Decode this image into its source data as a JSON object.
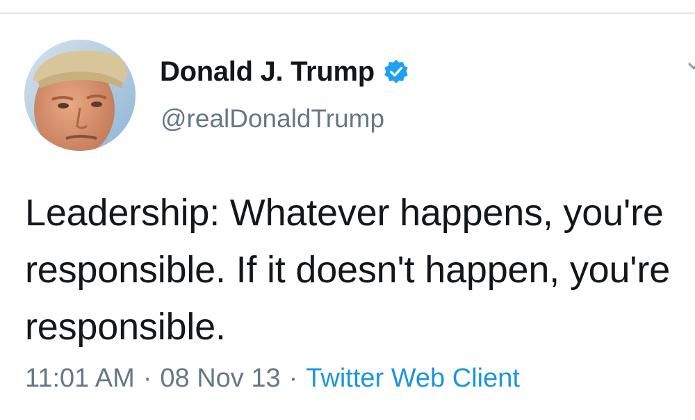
{
  "tweet": {
    "author": {
      "display_name": "Donald J. Trump",
      "handle": "@realDonaldTrump",
      "verified": true,
      "avatar_icon": "user-avatar-portrait"
    },
    "text": "Leadership: Whatever happens, you're responsible. If it doesn't happen, you're responsible.",
    "time": "11:01 AM",
    "date": "08 Nov 13",
    "separator": "·",
    "source": "Twitter Web Client"
  },
  "colors": {
    "text_primary": "#14171a",
    "text_secondary": "#657786",
    "link": "#1b95e0",
    "verified_badge": "#1da1f2",
    "divider": "#e1e8ed"
  },
  "icons": {
    "verified": "verified-badge-icon",
    "caret": "chevron-down-icon"
  }
}
